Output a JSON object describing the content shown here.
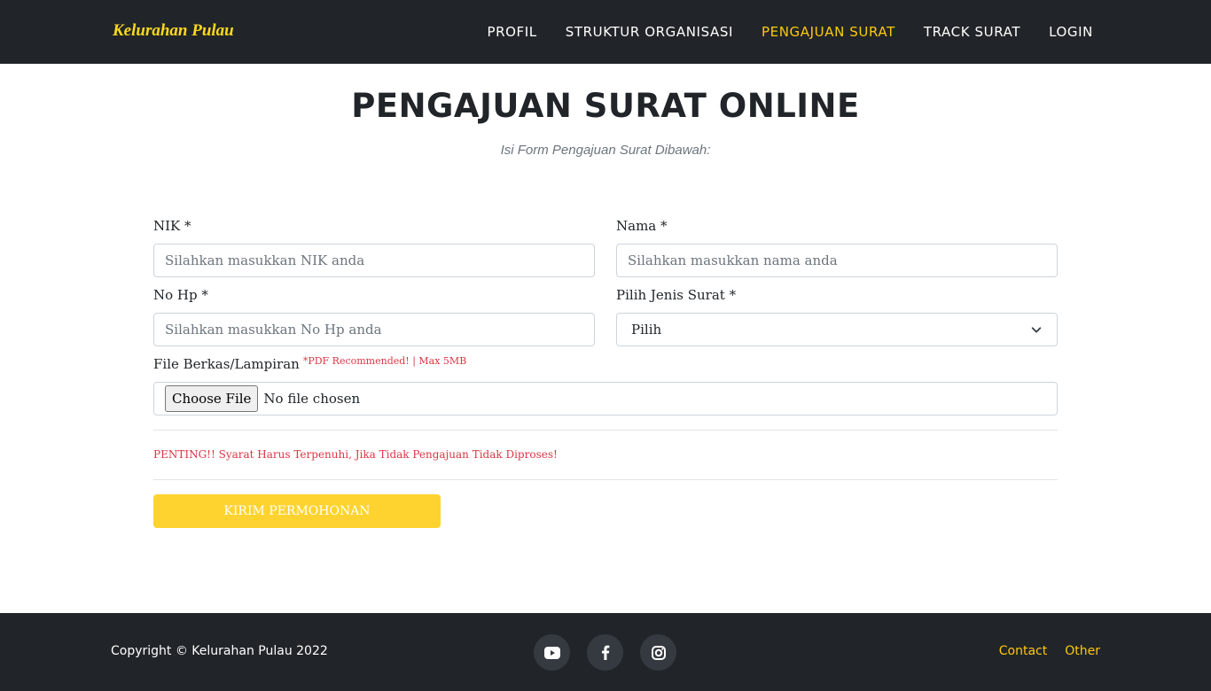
{
  "brand": "Kelurahan Pulau",
  "nav": {
    "items": [
      {
        "label": "PROFIL",
        "active": false
      },
      {
        "label": "STRUKTUR ORGANISASI",
        "active": false
      },
      {
        "label": "PENGAJUAN SURAT",
        "active": true
      },
      {
        "label": "TRACK SURAT",
        "active": false
      },
      {
        "label": "LOGIN",
        "active": false
      }
    ]
  },
  "page": {
    "title": "PENGAJUAN SURAT ONLINE",
    "subtitle": "Isi Form Pengajuan Surat Dibawah:"
  },
  "form": {
    "nik": {
      "label": "NIK *",
      "placeholder": "Silahkan masukkan NIK anda",
      "value": ""
    },
    "nama": {
      "label": "Nama *",
      "placeholder": "Silahkan masukkan nama anda",
      "value": ""
    },
    "nohp": {
      "label": "No Hp *",
      "placeholder": "Silahkan masukkan No Hp anda",
      "value": ""
    },
    "jenis": {
      "label": "Pilih Jenis Surat *",
      "selected": "Pilih"
    },
    "file": {
      "label": "File Berkas/Lampiran",
      "hint": "*PDF Recommended! | Max 5MB",
      "button": "Choose File",
      "status": "No file chosen"
    },
    "warning": "PENTING!! Syarat Harus Terpenuhi, Jika Tidak Pengajuan Tidak Diproses!",
    "submit": "KIRIM PERMOHONAN"
  },
  "footer": {
    "copyright": "Copyright © Kelurahan Pulau 2022",
    "socials": [
      "youtube-icon",
      "facebook-icon",
      "instagram-icon"
    ],
    "links": [
      "Contact",
      "Other"
    ]
  },
  "colors": {
    "navbar_bg": "#212529",
    "accent": "#fec810",
    "submit_bg": "#fed330",
    "danger": "#dc3545"
  }
}
